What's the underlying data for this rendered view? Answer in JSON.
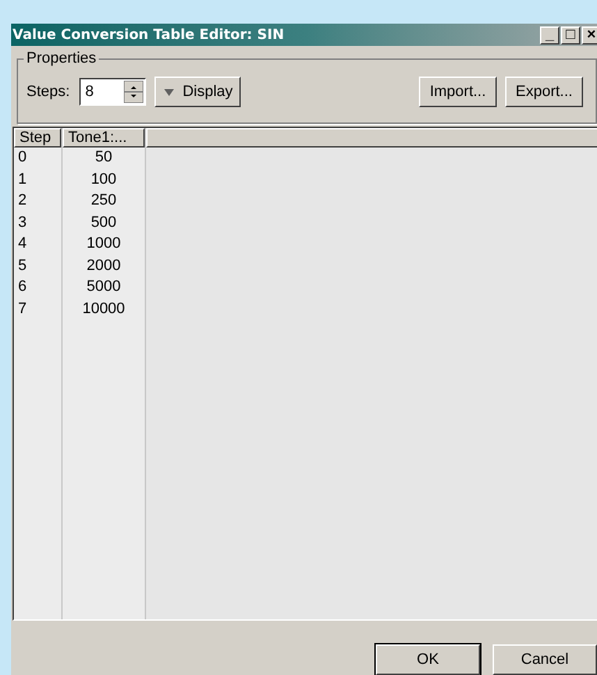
{
  "window": {
    "title": "Value Conversion Table Editor: SIN",
    "controls": [
      "_",
      "□",
      "×"
    ]
  },
  "properties": {
    "legend": "Properties",
    "steps_label": "Steps:",
    "steps_value": "8",
    "display_button": "Display",
    "import_button": "Import...",
    "export_button": "Export..."
  },
  "table": {
    "columns": [
      "Step",
      "Tone1:..."
    ],
    "rows": [
      [
        "0",
        "50"
      ],
      [
        "1",
        "100"
      ],
      [
        "2",
        "250"
      ],
      [
        "3",
        "500"
      ],
      [
        "4",
        "1000"
      ],
      [
        "5",
        "2000"
      ],
      [
        "6",
        "5000"
      ],
      [
        "7",
        "10000"
      ]
    ]
  },
  "buttons": [
    "OK",
    "Cancel"
  ]
}
